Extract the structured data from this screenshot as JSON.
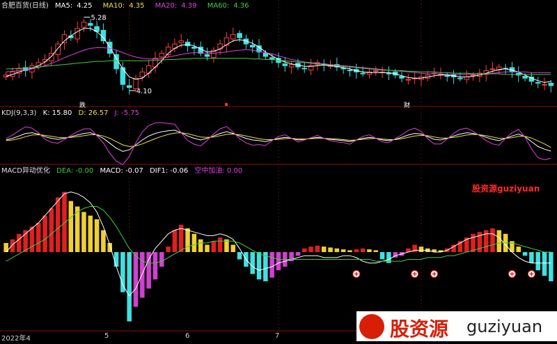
{
  "title": "合肥百货(日线)",
  "ma": [
    {
      "label": "MA5:",
      "value": "4.25",
      "color": "#ffffff"
    },
    {
      "label": "MA10:",
      "value": "4.35",
      "color": "#f0e040"
    },
    {
      "label": "MA20:",
      "value": "4.39",
      "color": "#e040e0"
    },
    {
      "label": "MA60:",
      "value": "4.36",
      "color": "#40d040"
    }
  ],
  "price_annotations": {
    "high": "5.28",
    "low": "4.10"
  },
  "event_marks": [
    "跌",
    "",
    ""
  ],
  "event_marks_b": "财",
  "kdj": {
    "name": "KDJ(9,3,3)",
    "k": "K: 15.80",
    "d": "D: 26.57",
    "j": "J: -5.75"
  },
  "macd": {
    "name": "MACD异动优化",
    "dea": "DEA: -0.00",
    "macd": "MACD: -0.07",
    "dif": "DIF1: -0.06",
    "extra": "空中加油: 0.00"
  },
  "watermark": "股资源guziyuan",
  "logo": {
    "cn": "股资源",
    "en": "guziyuan"
  },
  "x_labels": [
    "2022年4",
    "5",
    "6",
    "7"
  ],
  "colors": {
    "up": "#ff4040",
    "down": "#40e0e0",
    "bar_red": "#e02020",
    "bar_yellow": "#f0d030",
    "bar_cyan": "#40e0e0",
    "bar_magenta": "#d040d0"
  },
  "chart_data": {
    "type": "candlestick+indicators",
    "price": {
      "ylim": [
        3.9,
        5.4
      ],
      "close": [
        4.35,
        4.4,
        4.45,
        4.42,
        4.5,
        4.55,
        4.6,
        4.7,
        4.85,
        5.0,
        4.95,
        5.1,
        5.2,
        5.15,
        5.05,
        4.9,
        4.7,
        4.45,
        4.2,
        4.15,
        4.3,
        4.4,
        4.5,
        4.62,
        4.7,
        4.8,
        4.85,
        4.9,
        4.82,
        4.78,
        4.7,
        4.65,
        4.75,
        4.85,
        4.95,
        5.0,
        4.95,
        4.85,
        4.8,
        4.72,
        4.65,
        4.6,
        4.55,
        4.5,
        4.52,
        4.48,
        4.45,
        4.5,
        4.55,
        4.52,
        4.5,
        4.48,
        4.45,
        4.42,
        4.4,
        4.38,
        4.4,
        4.42,
        4.4,
        4.38,
        4.35,
        4.3,
        4.28,
        4.3,
        4.32,
        4.35,
        4.38,
        4.36,
        4.34,
        4.32,
        4.3,
        4.32,
        4.35,
        4.38,
        4.42,
        4.45,
        4.48,
        4.45,
        4.4,
        4.35,
        4.3,
        4.25,
        4.22,
        4.2,
        4.18
      ],
      "ma5": [
        4.33,
        4.36,
        4.4,
        4.43,
        4.46,
        4.5,
        4.56,
        4.65,
        4.78,
        4.9,
        4.98,
        5.05,
        5.1,
        5.1,
        5.05,
        4.95,
        4.8,
        4.62,
        4.45,
        4.32,
        4.28,
        4.3,
        4.38,
        4.48,
        4.58,
        4.7,
        4.78,
        4.83,
        4.84,
        4.82,
        4.77,
        4.72,
        4.73,
        4.77,
        4.84,
        4.9,
        4.92,
        4.9,
        4.86,
        4.8,
        4.72,
        4.66,
        4.6,
        4.56,
        4.53,
        4.51,
        4.49,
        4.49,
        4.5,
        4.51,
        4.5,
        4.49,
        4.47,
        4.45,
        4.42,
        4.4,
        4.39,
        4.39,
        4.39,
        4.39,
        4.37,
        4.34,
        4.31,
        4.3,
        4.3,
        4.32,
        4.34,
        4.35,
        4.35,
        4.34,
        4.32,
        4.32,
        4.33,
        4.35,
        4.38,
        4.41,
        4.44,
        4.45,
        4.43,
        4.4,
        4.35,
        4.3,
        4.26,
        4.23,
        4.25
      ],
      "ma20": [
        4.4,
        4.41,
        4.42,
        4.43,
        4.45,
        4.47,
        4.5,
        4.54,
        4.58,
        4.63,
        4.67,
        4.71,
        4.75,
        4.78,
        4.79,
        4.79,
        4.78,
        4.75,
        4.71,
        4.67,
        4.64,
        4.62,
        4.61,
        4.61,
        4.62,
        4.64,
        4.66,
        4.68,
        4.7,
        4.71,
        4.71,
        4.7,
        4.7,
        4.71,
        4.72,
        4.74,
        4.75,
        4.76,
        4.75,
        4.73,
        4.71,
        4.69,
        4.66,
        4.63,
        4.6,
        4.58,
        4.56,
        4.55,
        4.54,
        4.53,
        4.52,
        4.51,
        4.5,
        4.49,
        4.48,
        4.47,
        4.46,
        4.45,
        4.44,
        4.43,
        4.42,
        4.41,
        4.4,
        4.39,
        4.38,
        4.37,
        4.37,
        4.37,
        4.36,
        4.36,
        4.36,
        4.36,
        4.36,
        4.37,
        4.37,
        4.38,
        4.39,
        4.4,
        4.4,
        4.4,
        4.4,
        4.39,
        4.39,
        4.39,
        4.39
      ],
      "ma60": [
        4.45,
        4.45,
        4.46,
        4.46,
        4.47,
        4.48,
        4.49,
        4.5,
        4.51,
        4.52,
        4.53,
        4.54,
        4.55,
        4.56,
        4.57,
        4.57,
        4.58,
        4.58,
        4.58,
        4.58,
        4.58,
        4.58,
        4.58,
        4.59,
        4.59,
        4.6,
        4.6,
        4.61,
        4.61,
        4.62,
        4.62,
        4.62,
        4.62,
        4.62,
        4.62,
        4.62,
        4.62,
        4.62,
        4.61,
        4.61,
        4.6,
        4.6,
        4.59,
        4.58,
        4.57,
        4.56,
        4.55,
        4.54,
        4.53,
        4.52,
        4.51,
        4.5,
        4.49,
        4.48,
        4.47,
        4.46,
        4.45,
        4.44,
        4.43,
        4.43,
        4.42,
        4.42,
        4.41,
        4.41,
        4.4,
        4.4,
        4.4,
        4.39,
        4.39,
        4.38,
        4.38,
        4.38,
        4.37,
        4.37,
        4.37,
        4.37,
        4.37,
        4.36,
        4.36,
        4.36,
        4.36,
        4.36,
        4.36,
        4.36,
        4.36
      ]
    },
    "kdj": {
      "ylim": [
        -20,
        120
      ],
      "k": [
        50,
        55,
        62,
        70,
        72,
        68,
        60,
        55,
        52,
        55,
        60,
        65,
        70,
        72,
        65,
        55,
        40,
        25,
        15,
        20,
        35,
        50,
        62,
        70,
        75,
        78,
        80,
        72,
        62,
        55,
        50,
        55,
        62,
        70,
        75,
        70,
        62,
        55,
        50,
        48,
        45,
        50,
        55,
        58,
        55,
        50,
        52,
        55,
        58,
        55,
        52,
        50,
        48,
        45,
        50,
        55,
        58,
        55,
        50,
        48,
        52,
        58,
        65,
        70,
        68,
        60,
        52,
        50,
        55,
        62,
        68,
        72,
        70,
        65,
        58,
        52,
        48,
        55,
        62,
        68,
        60,
        45,
        30,
        22,
        16
      ],
      "d": [
        48,
        50,
        54,
        60,
        65,
        66,
        64,
        61,
        58,
        57,
        58,
        60,
        63,
        66,
        66,
        62,
        55,
        45,
        35,
        30,
        32,
        38,
        46,
        54,
        61,
        67,
        71,
        72,
        69,
        64,
        59,
        58,
        59,
        63,
        67,
        68,
        66,
        62,
        58,
        54,
        51,
        51,
        52,
        54,
        55,
        53,
        53,
        54,
        55,
        55,
        54,
        53,
        51,
        49,
        50,
        52,
        54,
        55,
        53,
        51,
        51,
        54,
        58,
        62,
        64,
        63,
        59,
        56,
        56,
        58,
        61,
        65,
        67,
        66,
        63,
        59,
        55,
        55,
        57,
        61,
        61,
        56,
        47,
        38,
        27
      ],
      "j": [
        54,
        65,
        78,
        90,
        86,
        72,
        52,
        43,
        40,
        51,
        64,
        75,
        84,
        84,
        63,
        41,
        10,
        -15,
        -25,
        0,
        41,
        74,
        94,
        102,
        103,
        100,
        98,
        72,
        48,
        37,
        32,
        49,
        68,
        84,
        91,
        74,
        54,
        41,
        34,
        36,
        33,
        48,
        61,
        66,
        55,
        44,
        50,
        57,
        64,
        55,
        48,
        44,
        42,
        37,
        50,
        61,
        66,
        55,
        44,
        42,
        54,
        66,
        79,
        86,
        76,
        54,
        38,
        38,
        53,
        70,
        82,
        86,
        76,
        63,
        48,
        38,
        34,
        55,
        72,
        82,
        58,
        23,
        -4,
        -10,
        -6
      ]
    },
    "macd": {
      "ylim": [
        -0.42,
        0.42
      ],
      "hist": [
        0.05,
        0.07,
        0.1,
        0.12,
        0.14,
        0.16,
        0.2,
        0.24,
        0.3,
        0.33,
        0.28,
        0.25,
        0.22,
        0.2,
        0.18,
        0.12,
        0.05,
        -0.08,
        -0.22,
        -0.38,
        -0.3,
        -0.25,
        -0.2,
        -0.15,
        -0.08,
        0.03,
        0.12,
        0.15,
        0.13,
        0.1,
        0.07,
        0.04,
        0.06,
        0.08,
        0.07,
        0.04,
        -0.04,
        -0.08,
        -0.12,
        -0.15,
        -0.16,
        -0.14,
        -0.1,
        -0.08,
        -0.05,
        -0.02,
        0.02,
        0.03,
        0.035,
        0.03,
        0.025,
        0.02,
        0.015,
        0.01,
        0.015,
        0.02,
        0.015,
        0.01,
        -0.04,
        -0.06,
        -0.03,
        -0.02,
        0.02,
        0.04,
        0.03,
        0.02,
        0.015,
        0.01,
        0.02,
        0.04,
        0.06,
        0.08,
        0.1,
        0.11,
        0.12,
        0.13,
        0.12,
        0.1,
        0.06,
        0.03,
        -0.02,
        -0.06,
        -0.1,
        -0.13,
        -0.16
      ],
      "dif": [
        0.0,
        0.04,
        0.07,
        0.1,
        0.13,
        0.16,
        0.2,
        0.24,
        0.28,
        0.32,
        0.33,
        0.32,
        0.3,
        0.27,
        0.22,
        0.14,
        0.04,
        -0.08,
        -0.18,
        -0.24,
        -0.2,
        -0.12,
        -0.04,
        0.02,
        0.06,
        0.1,
        0.12,
        0.13,
        0.12,
        0.11,
        0.1,
        0.09,
        0.09,
        0.1,
        0.09,
        0.07,
        0.02,
        -0.04,
        -0.08,
        -0.1,
        -0.09,
        -0.08,
        -0.06,
        -0.05,
        -0.04,
        -0.03,
        -0.02,
        -0.02,
        -0.02,
        -0.03,
        -0.03,
        -0.03,
        -0.02,
        -0.02,
        -0.03,
        -0.05,
        -0.06,
        -0.06,
        -0.05,
        -0.04,
        -0.02,
        -0.01,
        0.0,
        0.01,
        0.01,
        0.01,
        0.0,
        0.0,
        0.01,
        0.03,
        0.05,
        0.07,
        0.08,
        0.09,
        0.1,
        0.1,
        0.08,
        0.04,
        0.0,
        -0.03,
        -0.05,
        -0.06,
        -0.06,
        -0.06,
        -0.06
      ],
      "dea": [
        -0.05,
        -0.03,
        -0.01,
        0.01,
        0.03,
        0.05,
        0.07,
        0.1,
        0.13,
        0.16,
        0.19,
        0.22,
        0.24,
        0.25,
        0.25,
        0.23,
        0.19,
        0.14,
        0.08,
        0.02,
        -0.02,
        -0.05,
        -0.06,
        -0.06,
        -0.05,
        -0.03,
        -0.01,
        0.01,
        0.03,
        0.04,
        0.05,
        0.05,
        0.06,
        0.06,
        0.06,
        0.06,
        0.05,
        0.03,
        0.01,
        -0.01,
        -0.02,
        -0.03,
        -0.04,
        -0.04,
        -0.04,
        -0.04,
        -0.04,
        -0.04,
        -0.04,
        -0.04,
        -0.04,
        -0.04,
        -0.04,
        -0.04,
        -0.04,
        -0.04,
        -0.04,
        -0.05,
        -0.05,
        -0.05,
        -0.05,
        -0.05,
        -0.04,
        -0.04,
        -0.04,
        -0.03,
        -0.03,
        -0.03,
        -0.02,
        -0.02,
        -0.01,
        0.0,
        0.01,
        0.02,
        0.03,
        0.04,
        0.05,
        0.05,
        0.05,
        0.04,
        0.03,
        0.02,
        0.01,
        0.0,
        0.0
      ],
      "signal_markers": [
        54,
        63,
        66,
        78,
        81,
        93
      ]
    },
    "x_tick_index": [
      0,
      19,
      42,
      64
    ]
  }
}
